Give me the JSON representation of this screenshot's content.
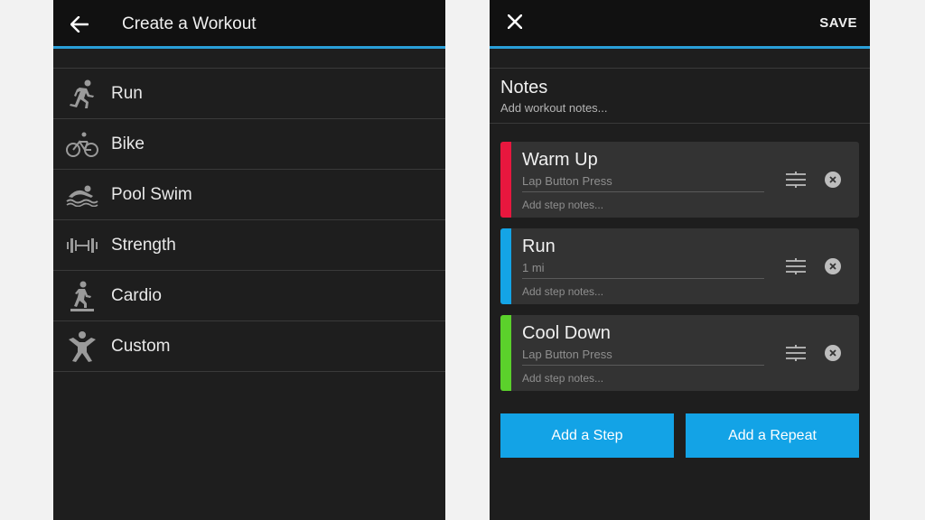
{
  "left": {
    "title": "Create a Workout",
    "items": [
      {
        "label": "Run",
        "icon": "run-icon"
      },
      {
        "label": "Bike",
        "icon": "bike-icon"
      },
      {
        "label": "Pool Swim",
        "icon": "swim-icon"
      },
      {
        "label": "Strength",
        "icon": "strength-icon"
      },
      {
        "label": "Cardio",
        "icon": "cardio-icon"
      },
      {
        "label": "Custom",
        "icon": "custom-icon"
      }
    ]
  },
  "right": {
    "save_label": "SAVE",
    "notes": {
      "title": "Notes",
      "placeholder": "Add workout notes..."
    },
    "steps": [
      {
        "name": "Warm Up",
        "duration": "Lap Button Press",
        "notes_placeholder": "Add step notes...",
        "color": "#e8173e"
      },
      {
        "name": "Run",
        "duration": "1 mi",
        "notes_placeholder": "Add step notes...",
        "color": "#14a4e6"
      },
      {
        "name": "Cool Down",
        "duration": "Lap Button Press",
        "notes_placeholder": "Add step notes...",
        "color": "#5bd12b"
      }
    ],
    "add_step_label": "Add a Step",
    "add_repeat_label": "Add a Repeat"
  },
  "colors": {
    "accent": "#2a9fd8",
    "button": "#13a3e6",
    "background": "#1e1e1e"
  }
}
